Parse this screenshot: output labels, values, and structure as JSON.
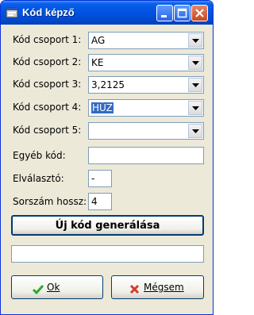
{
  "window": {
    "title": "Kód képző"
  },
  "fields": [
    {
      "label": "Kód csoport 1:",
      "value": "AG",
      "selected": false
    },
    {
      "label": "Kód csoport 2:",
      "value": "KE",
      "selected": false
    },
    {
      "label": "Kód csoport 3:",
      "value": "3,2125",
      "selected": false
    },
    {
      "label": "Kód csoport 4:",
      "value": "HÚZ",
      "selected": true
    },
    {
      "label": "Kód csoport 5:",
      "value": "",
      "selected": false
    }
  ],
  "other_code": {
    "label": "Egyéb kód:",
    "value": ""
  },
  "separator": {
    "label": "Elválasztó:",
    "value": "-"
  },
  "serial_length": {
    "label": "Sorszám hossz:",
    "value": "4"
  },
  "generate_button": {
    "label": "Új kód generálása"
  },
  "result": {
    "value": ""
  },
  "ok_button": {
    "label": "Ok"
  },
  "cancel_button": {
    "label": "Mégsem"
  },
  "colors": {
    "title_bar": "#0054e3",
    "window_bg": "#ece9d8",
    "ok_icon": "#2ea82e",
    "cancel_icon": "#d43a2a",
    "selection": "#316ac5"
  }
}
